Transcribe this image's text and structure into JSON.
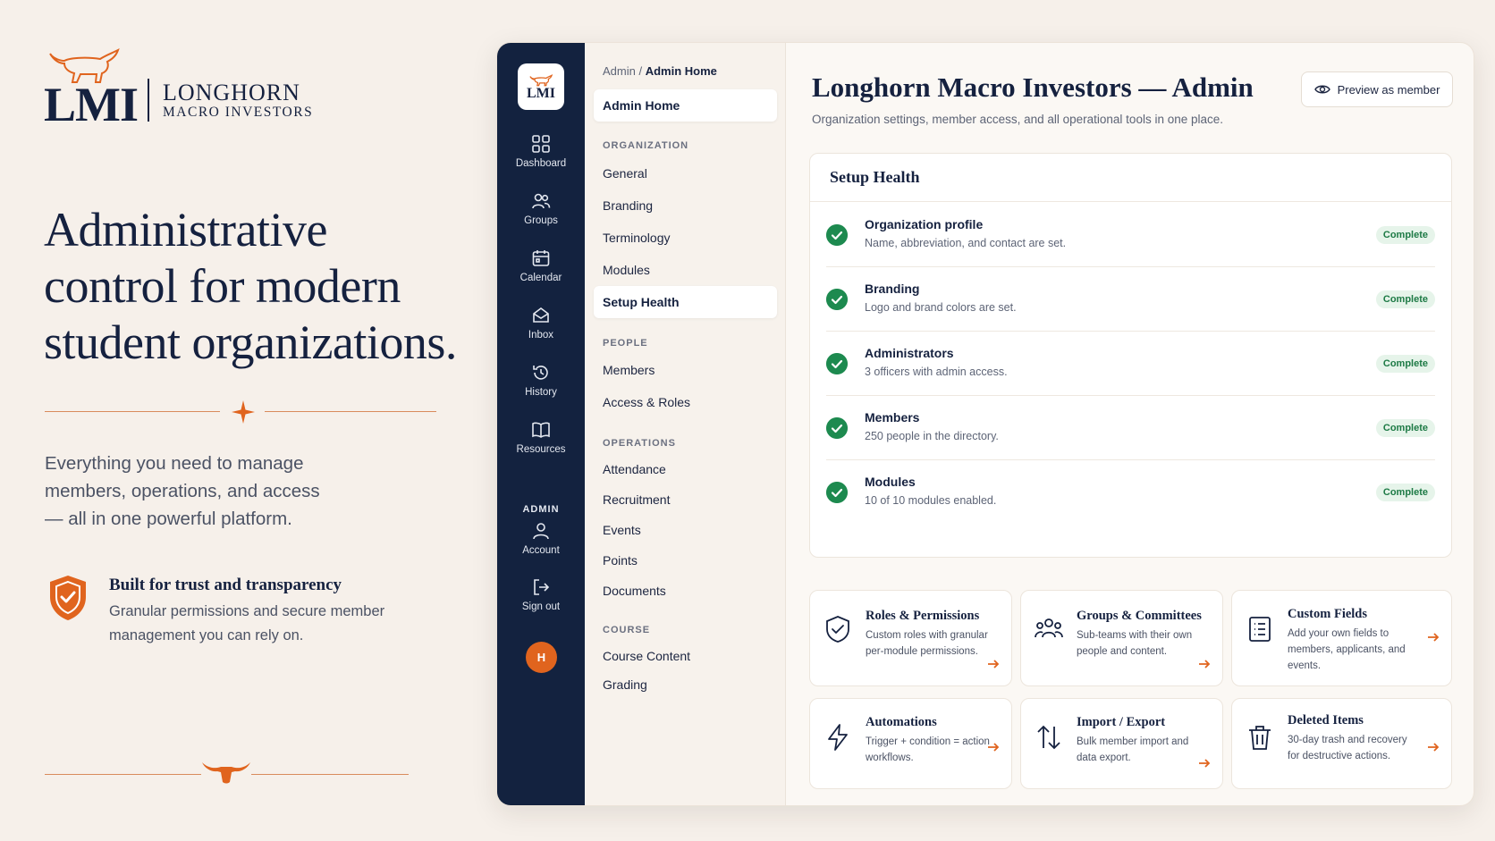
{
  "brand": {
    "abbr": "LMI",
    "name": "LONGHORN",
    "subname": "MACRO INVESTORS",
    "accent": "#e0641e",
    "navy": "#15213f"
  },
  "hero": {
    "headline_lines": [
      "Administrative",
      "control for modern",
      "student organizations."
    ],
    "subtext_lines": [
      "Everything you need to manage",
      "members, operations, and access",
      "— all in one powerful platform."
    ],
    "trust_title": "Built for trust and transparency",
    "trust_text_lines": [
      "Granular permissions and secure member",
      "management you can rely on."
    ]
  },
  "rail": {
    "logo_text": "LMI",
    "items": [
      {
        "label": "Dashboard",
        "icon": "grid-icon"
      },
      {
        "label": "Groups",
        "icon": "users-icon"
      },
      {
        "label": "Calendar",
        "icon": "calendar-icon"
      },
      {
        "label": "Inbox",
        "icon": "inbox-icon"
      },
      {
        "label": "History",
        "icon": "history-icon"
      },
      {
        "label": "Resources",
        "icon": "book-icon"
      }
    ],
    "admin_label": "ADMIN",
    "account_label": "Account",
    "signout_label": "Sign out",
    "avatar_initial": "H"
  },
  "subnav": {
    "breadcrumb_root": "Admin",
    "breadcrumb_sep": " / ",
    "breadcrumb_current": "Admin Home",
    "home": "Admin Home",
    "sections": [
      {
        "title": "ORGANIZATION",
        "items": [
          "General",
          "Branding",
          "Terminology",
          "Modules",
          "Setup Health"
        ]
      },
      {
        "title": "PEOPLE",
        "items": [
          "Members",
          "Access & Roles"
        ]
      },
      {
        "title": "OPERATIONS",
        "items": [
          "Attendance",
          "Recruitment",
          "Events",
          "Points",
          "Documents"
        ]
      },
      {
        "title": "COURSE",
        "items": [
          "Course Content",
          "Grading"
        ]
      }
    ],
    "active_item": "Setup Health"
  },
  "main": {
    "title": "Longhorn Macro Investors — Admin",
    "description": "Organization settings, member access, and all operational tools in one place.",
    "preview_button": "Preview as member",
    "health": {
      "title": "Setup Health",
      "rows": [
        {
          "title": "Organization profile",
          "desc": "Name, abbreviation, and contact are set.",
          "status": "Complete"
        },
        {
          "title": "Branding",
          "desc": "Logo and brand colors are set.",
          "status": "Complete"
        },
        {
          "title": "Administrators",
          "desc": "3 officers with admin access.",
          "status": "Complete"
        },
        {
          "title": "Members",
          "desc": "250 people in the directory.",
          "status": "Complete"
        },
        {
          "title": "Modules",
          "desc": "10 of 10 modules enabled.",
          "status": "Complete"
        }
      ]
    },
    "tiles": [
      {
        "title": "Roles & Permissions",
        "desc": "Custom roles with granular per-module permissions.",
        "icon": "shield-check-icon"
      },
      {
        "title": "Groups & Committees",
        "desc": "Sub-teams with their own people and content.",
        "icon": "group-icon"
      },
      {
        "title": "Custom Fields",
        "desc": "Add your own fields to members, applicants, and events.",
        "icon": "list-icon"
      },
      {
        "title": "Automations",
        "desc": "Trigger + condition = action workflows.",
        "icon": "bolt-icon"
      },
      {
        "title": "Import / Export",
        "desc": "Bulk member import and data export.",
        "icon": "arrows-updown-icon"
      },
      {
        "title": "Deleted Items",
        "desc": "30-day trash and recovery for destructive actions.",
        "icon": "trash-icon"
      }
    ]
  }
}
